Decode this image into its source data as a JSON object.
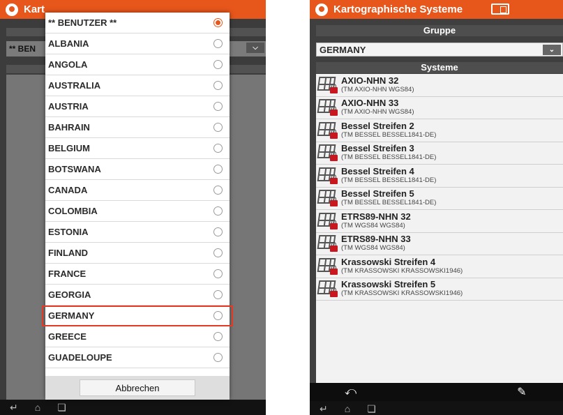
{
  "left_screen": {
    "title_partial": "Kart",
    "group_dropdown_value_partial": "** BEN",
    "country_dialog": {
      "items": [
        {
          "label": "** BENUTZER **",
          "selected": true
        },
        {
          "label": "ALBANIA",
          "selected": false
        },
        {
          "label": "ANGOLA",
          "selected": false
        },
        {
          "label": "AUSTRALIA",
          "selected": false
        },
        {
          "label": "AUSTRIA",
          "selected": false
        },
        {
          "label": "BAHRAIN",
          "selected": false
        },
        {
          "label": "BELGIUM",
          "selected": false
        },
        {
          "label": "BOTSWANA",
          "selected": false
        },
        {
          "label": "CANADA",
          "selected": false
        },
        {
          "label": "COLOMBIA",
          "selected": false
        },
        {
          "label": "ESTONIA",
          "selected": false
        },
        {
          "label": "FINLAND",
          "selected": false
        },
        {
          "label": "FRANCE",
          "selected": false
        },
        {
          "label": "GEORGIA",
          "selected": false
        },
        {
          "label": "GERMANY",
          "selected": false,
          "highlighted": true
        },
        {
          "label": "GREECE",
          "selected": false
        },
        {
          "label": "GUADELOUPE",
          "selected": false
        }
      ],
      "cancel_label": "Abbrechen"
    }
  },
  "right_screen": {
    "title": "Kartographische Systeme",
    "group_header": "Gruppe",
    "group_value": "GERMANY",
    "systems_header": "Systeme",
    "systems": [
      {
        "name": "AXIO-NHN 32",
        "sub": "(TM AXIO-NHN WGS84)"
      },
      {
        "name": "AXIO-NHN 33",
        "sub": "(TM AXIO-NHN WGS84)"
      },
      {
        "name": "Bessel Streifen 2",
        "sub": "(TM BESSEL BESSEL1841-DE)"
      },
      {
        "name": "Bessel Streifen 3",
        "sub": "(TM BESSEL BESSEL1841-DE)"
      },
      {
        "name": "Bessel Streifen 4",
        "sub": "(TM BESSEL BESSEL1841-DE)"
      },
      {
        "name": "Bessel Streifen 5",
        "sub": "(TM BESSEL BESSEL1841-DE)"
      },
      {
        "name": "ETRS89-NHN 32",
        "sub": "(TM WGS84 WGS84)"
      },
      {
        "name": "ETRS89-NHN 33",
        "sub": "(TM WGS84 WGS84)"
      },
      {
        "name": "Krassowski Streifen 4",
        "sub": "(TM KRASSOWSKI KRASSOWSKI1946)"
      },
      {
        "name": "Krassowski Streifen 5",
        "sub": "(TM KRASSOWSKI KRASSOWSKI1946)"
      }
    ]
  },
  "colors": {
    "accent": "#e7561b",
    "highlight_border": "#e23a24",
    "lock_red": "#c8171f"
  },
  "icons": [
    "app-icon",
    "battery-icon",
    "chevron-down-icon",
    "map-lock-icon",
    "back-icon",
    "edit-pencil-icon",
    "home-icon",
    "recent-apps-icon"
  ]
}
